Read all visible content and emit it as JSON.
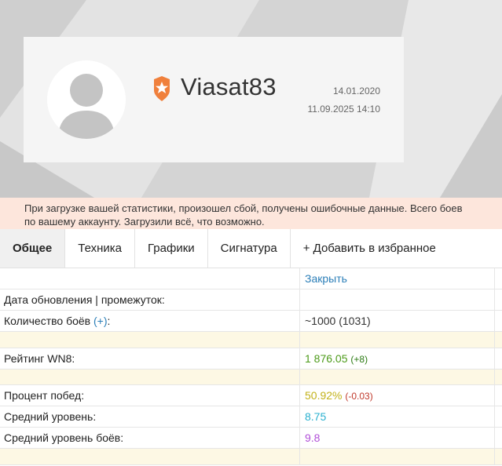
{
  "profile": {
    "username": "Viasat83",
    "registered": "14.01.2020",
    "last_battle": "11.09.2025 14:10"
  },
  "alert": {
    "line1": "При загрузке вашей статистики, произошел сбой, получены ошибочные данные. Всего боев",
    "line2": "по вашему аккаунту. Загрузили всё, что возможно."
  },
  "tabs": {
    "general": "Общее",
    "tech": "Техника",
    "charts": "Графики",
    "signature": "Сигнатура",
    "favorite": "+ Добавить в избранное"
  },
  "stats": {
    "close_label": "Закрыть",
    "update_label": "Дата обновления | промежуток:",
    "update_value": "",
    "battles_label": "Количество боёв",
    "battles_plus": "(+)",
    "battles_colon": ":",
    "battles_value": "~1000 (1031)",
    "wn8_label": "Рейтинг WN8:",
    "wn8_value": "1 876.05",
    "wn8_delta": "(+8)",
    "winrate_label": "Процент побед:",
    "winrate_value": "50.92%",
    "winrate_delta": "(-0.03)",
    "avg_tier_label": "Средний уровень:",
    "avg_tier_value": "8.75",
    "avg_battle_tier_label": "Средний уровень боёв:",
    "avg_battle_tier_value": "9.8"
  },
  "colors": {
    "wn8": "#4d9b1a",
    "winrate": "#c3b21a",
    "avg_tier": "#2ab0cf",
    "avg_battle_tier": "#b14fd8",
    "badge": "#f0803c"
  },
  "icons": {
    "avatar": "user-silhouette-icon",
    "badge": "star-shield-badge-icon"
  }
}
